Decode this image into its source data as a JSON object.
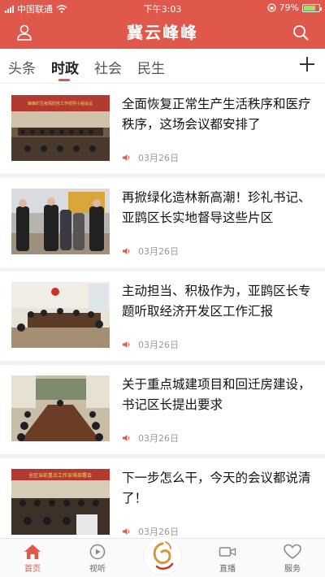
{
  "status_bar": {
    "carrier": "中国联通",
    "time": "下午3:03",
    "battery_percent": "79%",
    "battery_level": 0.79
  },
  "header": {
    "title": "冀云峰峰",
    "left_icon": "user-profile-icon",
    "right_icon": "search-icon"
  },
  "tabs": {
    "items": [
      {
        "label": "头条",
        "active": false
      },
      {
        "label": "时政",
        "active": true
      },
      {
        "label": "社会",
        "active": false
      },
      {
        "label": "民生",
        "active": false
      }
    ],
    "add_icon": "plus-icon"
  },
  "news": [
    {
      "title": "全面恢复正常生产生活秩序和医疗秩序，这场会议都安排了",
      "date": "03月26日",
      "thumb_banner": "峰峰矿区疫情防控工作领导小组会议"
    },
    {
      "title": "再掀绿化造林新高潮！珍礼书记、亚鹍区长实地督导这些片区",
      "date": "03月26日",
      "thumb_banner": ""
    },
    {
      "title": "主动担当、积极作为，亚鹍区长专题听取经济开发区工作汇报",
      "date": "03月26日",
      "thumb_banner": ""
    },
    {
      "title": "关于重点城建项目和回迁房建设，书记区长提出要求",
      "date": "03月26日",
      "thumb_banner": ""
    },
    {
      "title": "下一步怎么干，今天的会议都说清了！",
      "date": "03月26日",
      "thumb_banner": "全区当前重点工作安排部署会"
    }
  ],
  "bottom_nav": [
    {
      "label": "首页",
      "icon": "home-icon",
      "active": true
    },
    {
      "label": "视听",
      "icon": "play-icon",
      "active": false
    },
    {
      "label": "",
      "icon": "logo-icon",
      "active": false
    },
    {
      "label": "直播",
      "icon": "video-camera-icon",
      "active": false
    },
    {
      "label": "服务",
      "icon": "heart-icon",
      "active": false
    }
  ],
  "colors": {
    "brand_red": "#e0584c",
    "battery_green": "#9be36b"
  }
}
